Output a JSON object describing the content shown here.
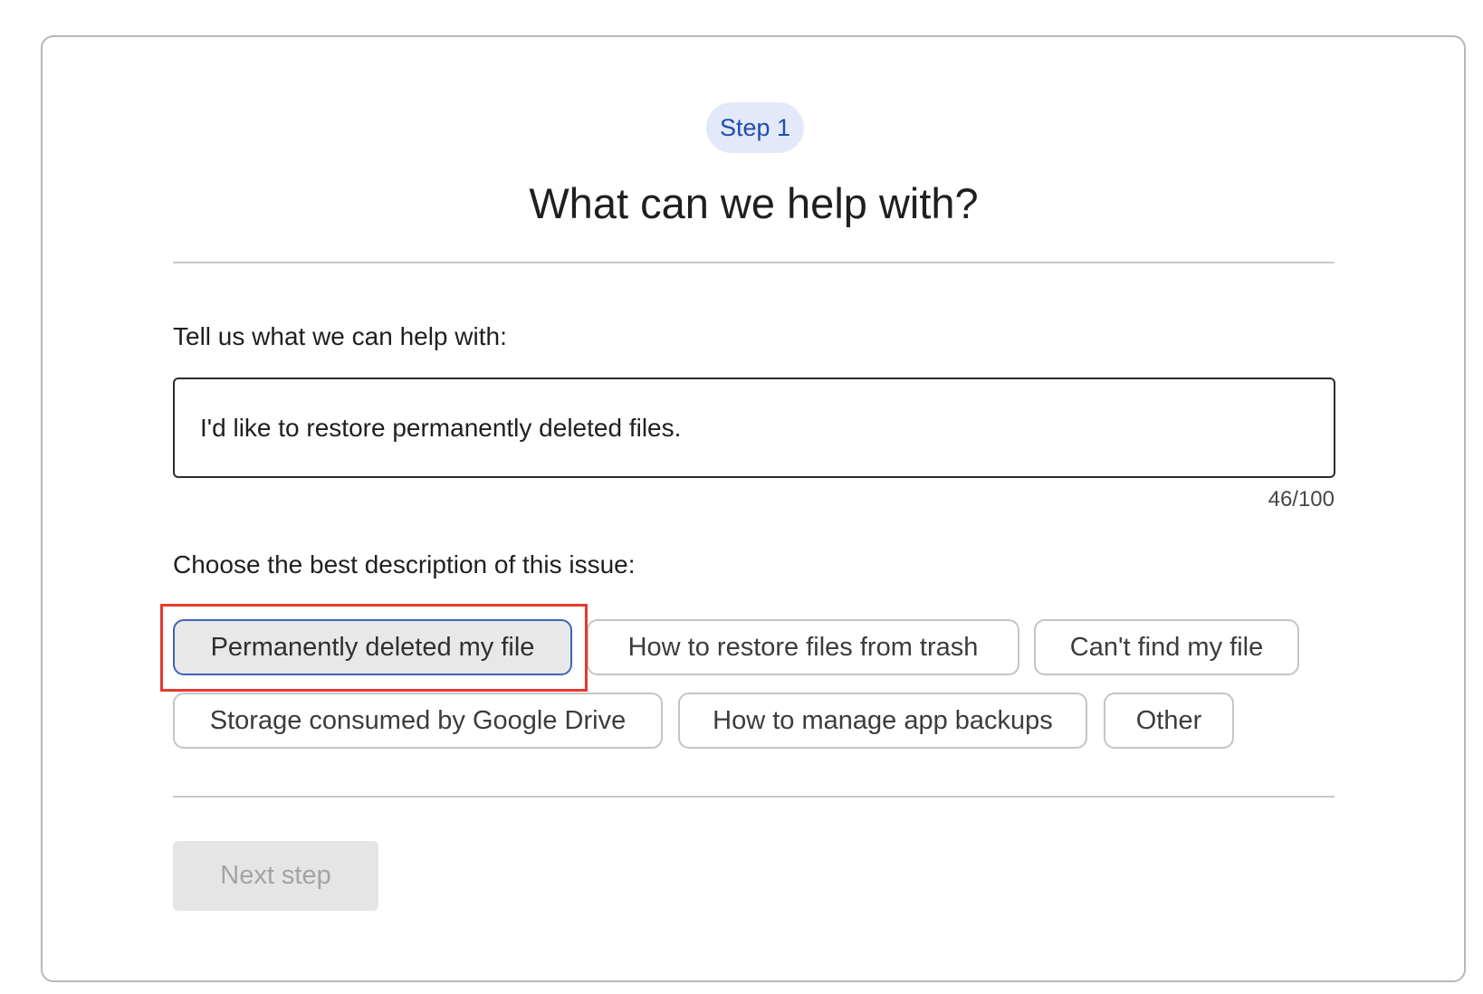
{
  "step": {
    "badge_label": "Step 1"
  },
  "header": {
    "title": "What can we help with?"
  },
  "help_field": {
    "label": "Tell us what we can help with:",
    "value": "I'd like to restore permanently deleted files.",
    "char_count": "46/100"
  },
  "issue_options": {
    "label": "Choose the best description of this issue:",
    "selected": "Permanently deleted my file",
    "chips": [
      {
        "label": "Permanently deleted my file",
        "selected": true
      },
      {
        "label": "How to restore files from trash",
        "selected": false
      },
      {
        "label": "Can't find my file",
        "selected": false
      },
      {
        "label": "Storage consumed by Google Drive",
        "selected": false
      },
      {
        "label": "How to manage app backups",
        "selected": false
      },
      {
        "label": "Other",
        "selected": false
      }
    ]
  },
  "actions": {
    "next_label": "Next step",
    "next_enabled": false
  },
  "colors": {
    "badge_background": "#e3e9f8",
    "badge_text": "#1f4db0",
    "selected_chip_border": "#3e63b8",
    "selected_chip_background": "#e8e8e8",
    "highlight_annotation": "#e8392d",
    "disabled_button_background": "#e5e5e5",
    "disabled_button_text": "#a3a3a3"
  }
}
